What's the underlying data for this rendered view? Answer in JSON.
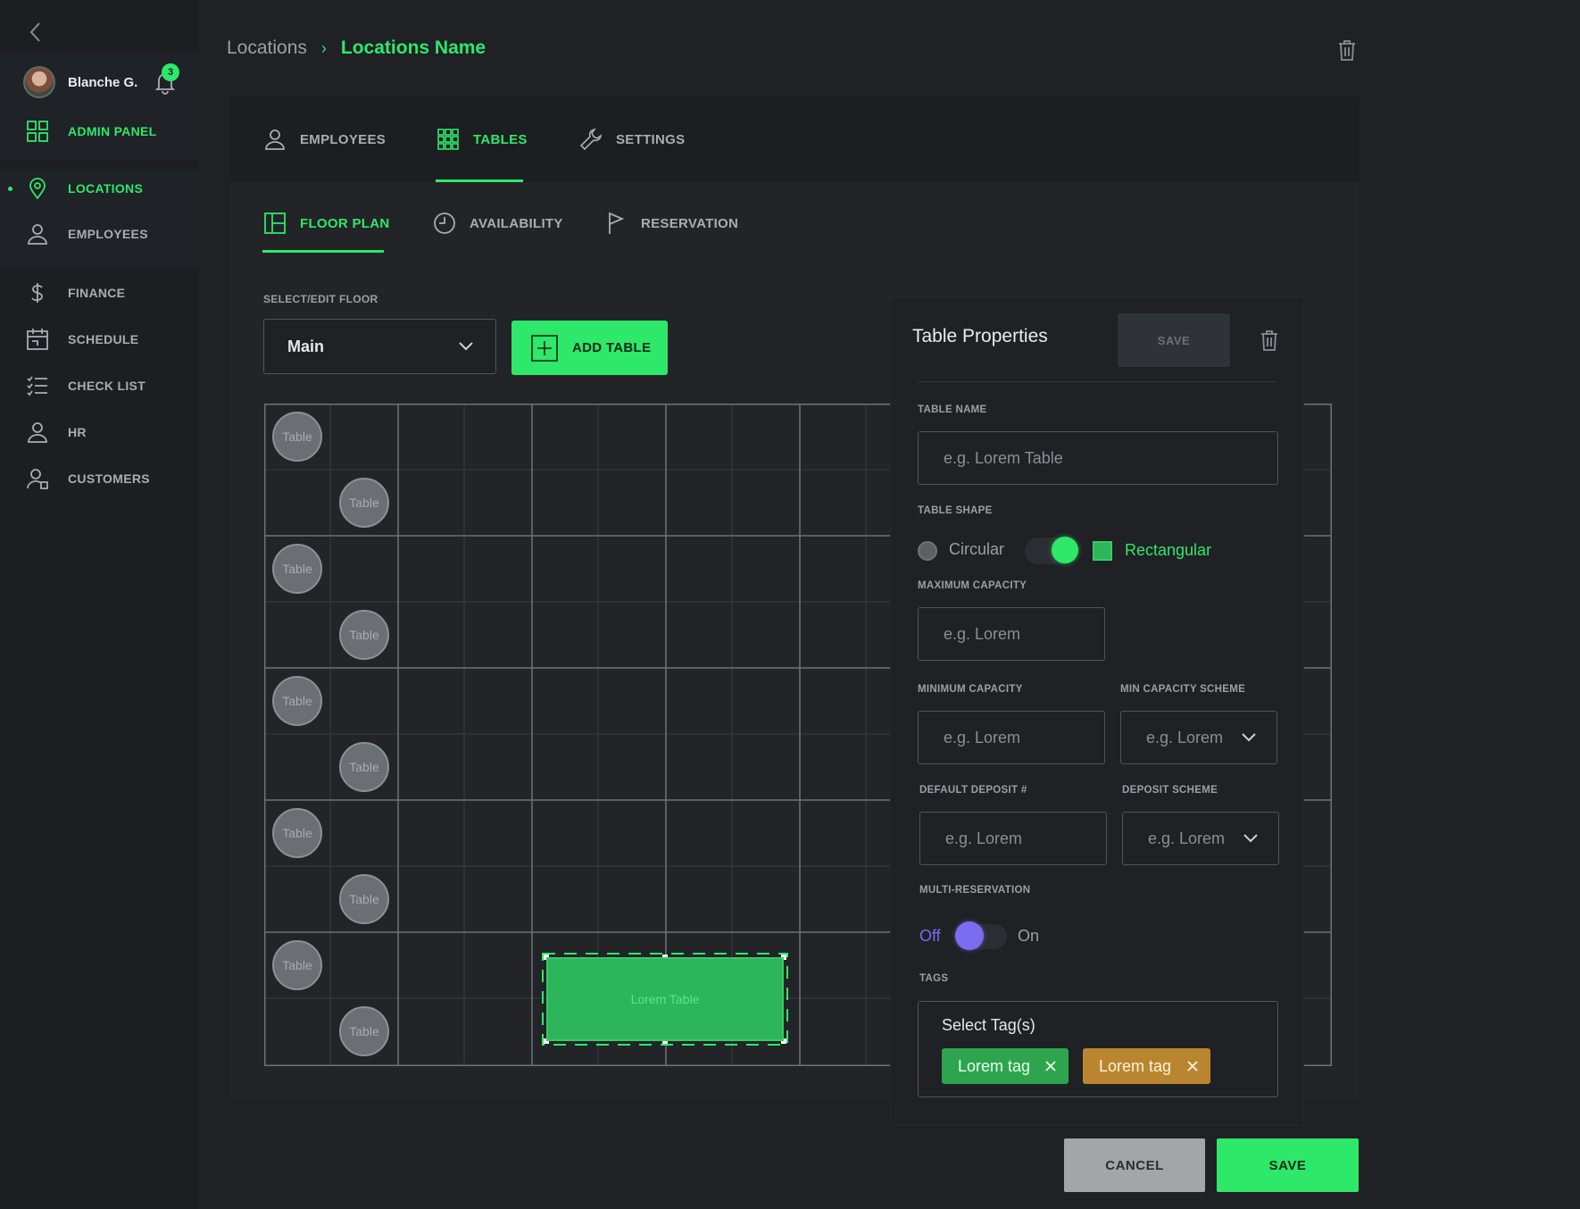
{
  "colors": {
    "accent": "#2ee86a",
    "purple": "#7b6cf0",
    "tag_green": "#2ea44f",
    "tag_orange": "#b9862f"
  },
  "sidebar": {
    "user": {
      "name": "Blanche G.",
      "notifications": "3"
    },
    "items": [
      {
        "label": "ADMIN PANEL",
        "icon": "grid-icon"
      },
      {
        "label": "LOCATIONS",
        "icon": "location-pin-icon"
      },
      {
        "label": "EMPLOYEES",
        "icon": "user-icon"
      },
      {
        "label": "FINANCE",
        "icon": "dollar-icon"
      },
      {
        "label": "SCHEDULE",
        "icon": "calendar-icon"
      },
      {
        "label": "CHECK LIST",
        "icon": "checklist-icon"
      },
      {
        "label": "HR",
        "icon": "user-icon"
      },
      {
        "label": "CUSTOMERS",
        "icon": "customers-icon"
      }
    ]
  },
  "breadcrumb": {
    "parent": "Locations",
    "current": "Locations Name"
  },
  "tabs": [
    {
      "label": "EMPLOYEES",
      "icon": "user-icon"
    },
    {
      "label": "TABLES",
      "icon": "tables-grid-icon"
    },
    {
      "label": "SETTINGS",
      "icon": "wrench-icon"
    }
  ],
  "subtabs": [
    {
      "label": "FLOOR PLAN",
      "icon": "floor-plan-icon"
    },
    {
      "label": "AVAILABILITY",
      "icon": "clock-icon"
    },
    {
      "label": "RESERVATION",
      "icon": "flag-icon"
    }
  ],
  "floor": {
    "label": "SELECT/EDIT FLOOR",
    "selected": "Main",
    "add_table": "ADD TABLE"
  },
  "floor_plan": {
    "circle_label": "Table",
    "rect_label": "Lorem Table"
  },
  "properties": {
    "title": "Table Properties",
    "save": "SAVE",
    "table_name": {
      "label": "TABLE NAME",
      "placeholder": "e.g. Lorem Table"
    },
    "table_shape": {
      "label": "TABLE SHAPE",
      "circular": "Circular",
      "rectangular": "Rectangular"
    },
    "max_capacity": {
      "label": "MAXIMUM CAPACITY",
      "placeholder": "e.g. Lorem"
    },
    "min_capacity": {
      "label": "MINIMUM CAPACITY",
      "placeholder": "e.g. Lorem"
    },
    "min_capacity_scheme": {
      "label": "MIN  CAPACITY SCHEME",
      "value": "e.g. Lorem"
    },
    "default_deposit": {
      "label": "DEFAULT DEPOSIT #",
      "placeholder": "e.g. Lorem"
    },
    "deposit_scheme": {
      "label": "DEPOSIT SCHEME",
      "value": "e.g. Lorem"
    },
    "multi_reservation": {
      "label": "MULTI-RESERVATION",
      "off": "Off",
      "on": "On"
    },
    "tags": {
      "label": "TAGS",
      "title": "Select Tag(s)",
      "items": [
        "Lorem tag",
        "Lorem tag"
      ]
    }
  },
  "footer": {
    "cancel": "CANCEL",
    "save": "SAVE"
  }
}
